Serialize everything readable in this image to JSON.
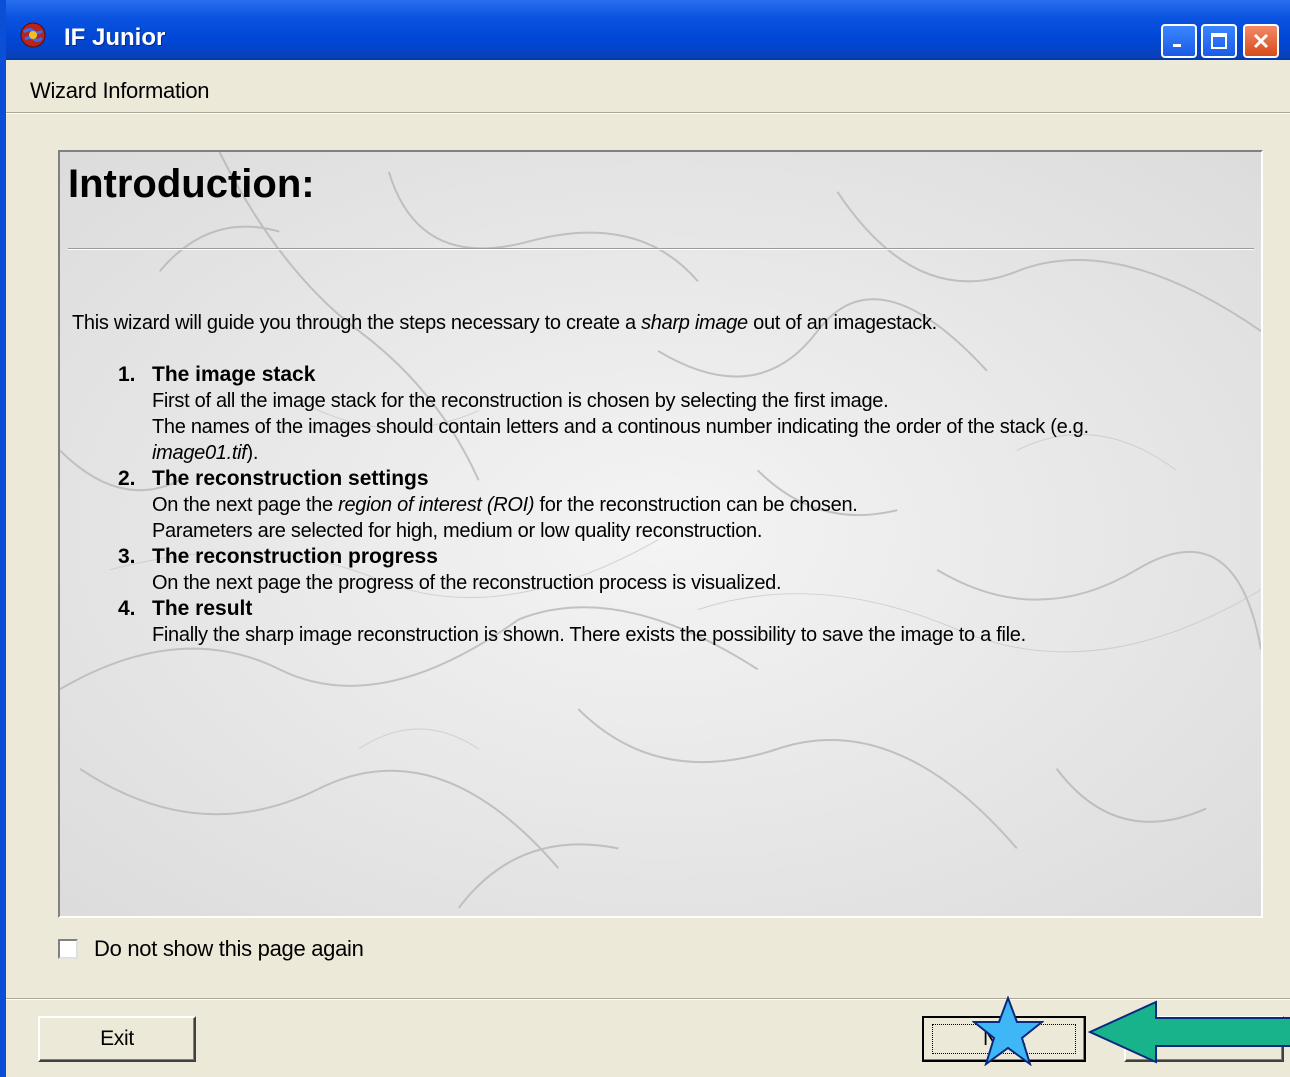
{
  "window": {
    "title": "IF Junior",
    "icon": "app-globe-icon",
    "controls": [
      "minimize-icon",
      "maximize-icon",
      "close-icon"
    ]
  },
  "header": {
    "label": "Wizard Information"
  },
  "content": {
    "title": "Introduction:",
    "intro_before": "This wizard will guide you through the steps necessary to create a ",
    "intro_em": "sharp image",
    "intro_after": " out of an imagestack.",
    "items": [
      {
        "number": "1.",
        "title": "The image stack",
        "line1": "First of all the image stack for the reconstruction is chosen by selecting the first image.",
        "line2": "The names of the images should contain letters and a continous number indicating the order of the stack (e.g.",
        "line3_em": "image01.tif",
        "line3_after": ")."
      },
      {
        "number": "2.",
        "title": "The reconstruction settings",
        "line1_before": "On the next page the ",
        "line1_em": "region of interest (ROI)",
        "line1_after": " for the reconstruction can be chosen.",
        "line2": "Parameters are selected for high, medium or low quality reconstruction."
      },
      {
        "number": "3.",
        "title": "The reconstruction progress",
        "line1": "On the next page the progress of the reconstruction process is visualized."
      },
      {
        "number": "4.",
        "title": "The result",
        "line1": "Finally the sharp image reconstruction is shown. There exists the possibility to save the image to a file."
      }
    ]
  },
  "checkbox": {
    "label": "Do not show this page again",
    "checked": false
  },
  "buttons": {
    "exit": "Exit",
    "next": "Next",
    "info": "Info"
  },
  "annotations": {
    "star_color": "#3fb6f5",
    "arrow_color": "#19b38b"
  }
}
